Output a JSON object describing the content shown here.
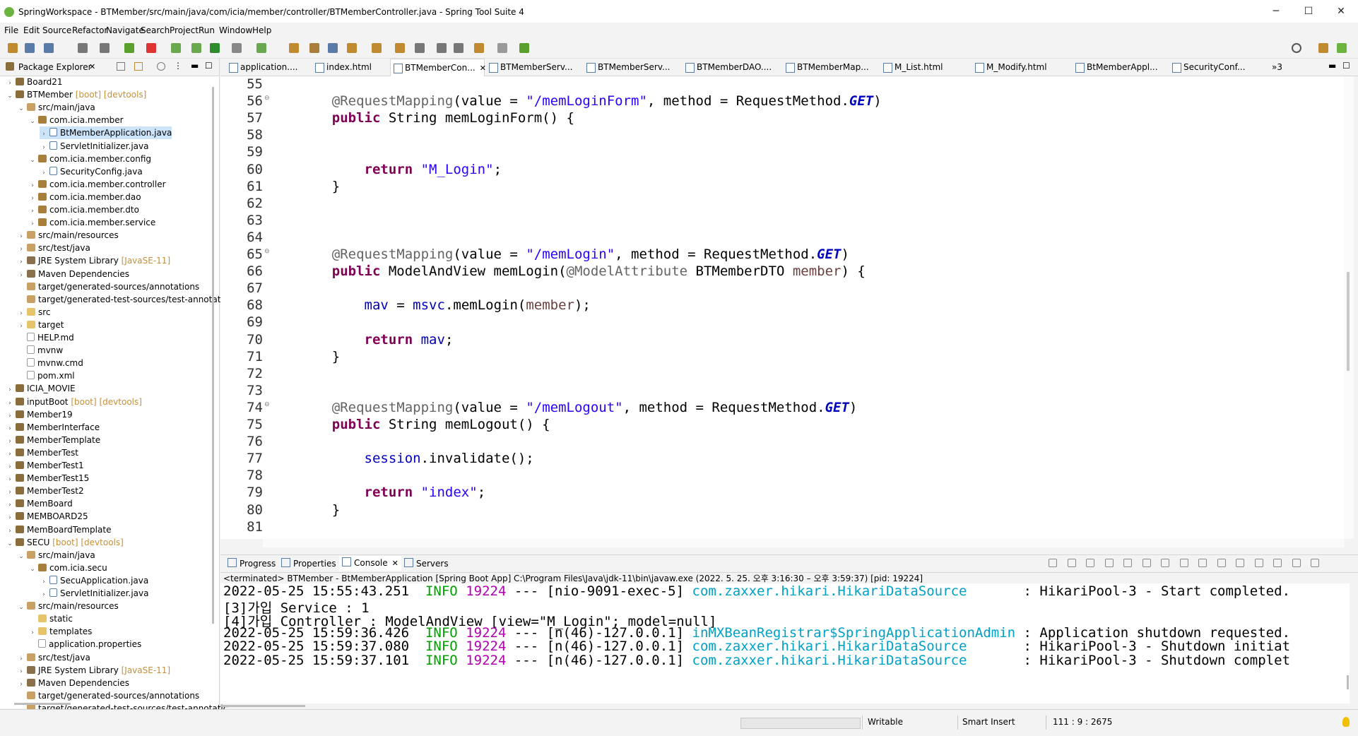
{
  "window": {
    "title": "SpringWorkspace - BTMember/src/main/java/com/icia/member/controller/BTMemberController.java - Spring Tool Suite 4",
    "minimize": "─",
    "maximize": "☐",
    "close": "✕"
  },
  "menu": [
    "File",
    "Edit",
    "Source",
    "Refactor",
    "Navigate",
    "Search",
    "Project",
    "Run",
    "Window",
    "Help"
  ],
  "package_explorer": {
    "title": "Package Explorer",
    "close": "✕",
    "tree": [
      {
        "label": "Board21",
        "deco": "",
        "depth": 0,
        "twisty": "›",
        "icon": "proj"
      },
      {
        "label": "BTMember",
        "deco": " [boot] [devtools]",
        "depth": 0,
        "twisty": "⌄",
        "icon": "proj"
      },
      {
        "label": "src/main/java",
        "deco": "",
        "depth": 1,
        "twisty": "⌄",
        "icon": "src"
      },
      {
        "label": "com.icia.member",
        "deco": "",
        "depth": 2,
        "twisty": "⌄",
        "icon": "pkg"
      },
      {
        "label": "BtMemberApplication.java",
        "deco": "",
        "depth": 3,
        "twisty": "›",
        "icon": "java",
        "selected": true
      },
      {
        "label": "ServletInitializer.java",
        "deco": "",
        "depth": 3,
        "twisty": "›",
        "icon": "java"
      },
      {
        "label": "com.icia.member.config",
        "deco": "",
        "depth": 2,
        "twisty": "⌄",
        "icon": "pkg"
      },
      {
        "label": "SecurityConfig.java",
        "deco": "",
        "depth": 3,
        "twisty": "›",
        "icon": "java"
      },
      {
        "label": "com.icia.member.controller",
        "deco": "",
        "depth": 2,
        "twisty": "›",
        "icon": "pkg"
      },
      {
        "label": "com.icia.member.dao",
        "deco": "",
        "depth": 2,
        "twisty": "›",
        "icon": "pkg"
      },
      {
        "label": "com.icia.member.dto",
        "deco": "",
        "depth": 2,
        "twisty": "›",
        "icon": "pkg"
      },
      {
        "label": "com.icia.member.service",
        "deco": "",
        "depth": 2,
        "twisty": "›",
        "icon": "pkg"
      },
      {
        "label": "src/main/resources",
        "deco": "",
        "depth": 1,
        "twisty": "›",
        "icon": "src"
      },
      {
        "label": "src/test/java",
        "deco": "",
        "depth": 1,
        "twisty": "›",
        "icon": "src"
      },
      {
        "label": "JRE System Library",
        "deco": " [JavaSE-11]",
        "depth": 1,
        "twisty": "›",
        "icon": "lib"
      },
      {
        "label": "Maven Dependencies",
        "deco": "",
        "depth": 1,
        "twisty": "›",
        "icon": "lib"
      },
      {
        "label": "target/generated-sources/annotations",
        "deco": "",
        "depth": 1,
        "twisty": "",
        "icon": "src"
      },
      {
        "label": "target/generated-test-sources/test-annotatic",
        "deco": "",
        "depth": 1,
        "twisty": "",
        "icon": "src"
      },
      {
        "label": "src",
        "deco": "",
        "depth": 1,
        "twisty": "›",
        "icon": "fold"
      },
      {
        "label": "target",
        "deco": "",
        "depth": 1,
        "twisty": "›",
        "icon": "fold"
      },
      {
        "label": "HELP.md",
        "deco": "",
        "depth": 1,
        "twisty": "",
        "icon": "file"
      },
      {
        "label": "mvnw",
        "deco": "",
        "depth": 1,
        "twisty": "",
        "icon": "file"
      },
      {
        "label": "mvnw.cmd",
        "deco": "",
        "depth": 1,
        "twisty": "",
        "icon": "file"
      },
      {
        "label": "pom.xml",
        "deco": "",
        "depth": 1,
        "twisty": "",
        "icon": "file"
      },
      {
        "label": "ICIA_MOVIE",
        "deco": "",
        "depth": 0,
        "twisty": "›",
        "icon": "proj"
      },
      {
        "label": "inputBoot",
        "deco": " [boot] [devtools]",
        "depth": 0,
        "twisty": "›",
        "icon": "proj"
      },
      {
        "label": "Member19",
        "deco": "",
        "depth": 0,
        "twisty": "›",
        "icon": "proj"
      },
      {
        "label": "MemberInterface",
        "deco": "",
        "depth": 0,
        "twisty": "›",
        "icon": "proj"
      },
      {
        "label": "MemberTemplate",
        "deco": "",
        "depth": 0,
        "twisty": "›",
        "icon": "proj"
      },
      {
        "label": "MemberTest",
        "deco": "",
        "depth": 0,
        "twisty": "›",
        "icon": "proj"
      },
      {
        "label": "MemberTest1",
        "deco": "",
        "depth": 0,
        "twisty": "›",
        "icon": "proj"
      },
      {
        "label": "MemberTest15",
        "deco": "",
        "depth": 0,
        "twisty": "›",
        "icon": "proj"
      },
      {
        "label": "MemberTest2",
        "deco": "",
        "depth": 0,
        "twisty": "›",
        "icon": "proj"
      },
      {
        "label": "MemBoard",
        "deco": "",
        "depth": 0,
        "twisty": "›",
        "icon": "proj"
      },
      {
        "label": "MEMBOARD25",
        "deco": "",
        "depth": 0,
        "twisty": "›",
        "icon": "proj"
      },
      {
        "label": "MemBoardTemplate",
        "deco": "",
        "depth": 0,
        "twisty": "›",
        "icon": "proj"
      },
      {
        "label": "SECU",
        "deco": " [boot] [devtools]",
        "depth": 0,
        "twisty": "⌄",
        "icon": "proj"
      },
      {
        "label": "src/main/java",
        "deco": "",
        "depth": 1,
        "twisty": "⌄",
        "icon": "src"
      },
      {
        "label": "com.icia.secu",
        "deco": "",
        "depth": 2,
        "twisty": "⌄",
        "icon": "pkg"
      },
      {
        "label": "SecuApplication.java",
        "deco": "",
        "depth": 3,
        "twisty": "›",
        "icon": "java"
      },
      {
        "label": "ServletInitializer.java",
        "deco": "",
        "depth": 3,
        "twisty": "›",
        "icon": "java"
      },
      {
        "label": "src/main/resources",
        "deco": "",
        "depth": 1,
        "twisty": "⌄",
        "icon": "src"
      },
      {
        "label": "static",
        "deco": "",
        "depth": 2,
        "twisty": "",
        "icon": "fold"
      },
      {
        "label": "templates",
        "deco": "",
        "depth": 2,
        "twisty": "›",
        "icon": "fold"
      },
      {
        "label": "application.properties",
        "deco": "",
        "depth": 2,
        "twisty": "",
        "icon": "file"
      },
      {
        "label": "src/test/java",
        "deco": "",
        "depth": 1,
        "twisty": "›",
        "icon": "src"
      },
      {
        "label": "JRE System Library",
        "deco": " [JavaSE-11]",
        "depth": 1,
        "twisty": "›",
        "icon": "lib"
      },
      {
        "label": "Maven Dependencies",
        "deco": "",
        "depth": 1,
        "twisty": "›",
        "icon": "lib"
      },
      {
        "label": "target/generated-sources/annotations",
        "deco": "",
        "depth": 1,
        "twisty": "",
        "icon": "src"
      },
      {
        "label": "target/generated-test-sources/test-annotatic",
        "deco": "",
        "depth": 1,
        "twisty": "",
        "icon": "src"
      }
    ]
  },
  "editor_tabs": [
    {
      "label": "application....",
      "active": false
    },
    {
      "label": "index.html",
      "active": false
    },
    {
      "label": "BTMemberCon...",
      "active": true
    },
    {
      "label": "BTMemberServ...",
      "active": false
    },
    {
      "label": "BTMemberServ...",
      "active": false
    },
    {
      "label": "BTMemberDAO....",
      "active": false
    },
    {
      "label": "BTMemberMap...",
      "active": false
    },
    {
      "label": "M_List.html",
      "active": false
    },
    {
      "label": "M_Modify.html",
      "active": false
    },
    {
      "label": "BtMemberAppl...",
      "active": false
    },
    {
      "label": "SecurityConf...",
      "active": false
    }
  ],
  "editor_overflow": "»3",
  "code_lines": [
    {
      "n": "55",
      "fold": false,
      "parts": []
    },
    {
      "n": "56",
      "fold": true,
      "parts": [
        [
          "    ",
          "t"
        ],
        [
          "@RequestMapping",
          "ann"
        ],
        [
          "(value = ",
          "t"
        ],
        [
          "\"/memLoginForm\"",
          "str"
        ],
        [
          ", method = RequestMethod.",
          "t"
        ],
        [
          "GET",
          "it"
        ],
        [
          ")",
          "t"
        ]
      ]
    },
    {
      "n": "57",
      "fold": false,
      "parts": [
        [
          "    ",
          "t"
        ],
        [
          "public",
          "kw"
        ],
        [
          " String memLoginForm() {",
          "t"
        ]
      ]
    },
    {
      "n": "58",
      "fold": false,
      "parts": []
    },
    {
      "n": "59",
      "fold": false,
      "parts": []
    },
    {
      "n": "60",
      "fold": false,
      "parts": [
        [
          "        ",
          "t"
        ],
        [
          "return",
          "kw"
        ],
        [
          " ",
          "t"
        ],
        [
          "\"M_Login\"",
          "str"
        ],
        [
          ";",
          "t"
        ]
      ]
    },
    {
      "n": "61",
      "fold": false,
      "parts": [
        [
          "    }",
          "t"
        ]
      ]
    },
    {
      "n": "62",
      "fold": false,
      "parts": []
    },
    {
      "n": "63",
      "fold": false,
      "parts": []
    },
    {
      "n": "64",
      "fold": false,
      "parts": []
    },
    {
      "n": "65",
      "fold": true,
      "parts": [
        [
          "    ",
          "t"
        ],
        [
          "@RequestMapping",
          "ann"
        ],
        [
          "(value = ",
          "t"
        ],
        [
          "\"/memLogin\"",
          "str"
        ],
        [
          ", method = RequestMethod.",
          "t"
        ],
        [
          "GET",
          "it"
        ],
        [
          ")",
          "t"
        ]
      ]
    },
    {
      "n": "66",
      "fold": false,
      "parts": [
        [
          "    ",
          "t"
        ],
        [
          "public",
          "kw"
        ],
        [
          " ModelAndView memLogin(",
          "t"
        ],
        [
          "@ModelAttribute",
          "ann"
        ],
        [
          " BTMemberDTO ",
          "t"
        ],
        [
          "member",
          "var"
        ],
        [
          ") {",
          "t"
        ]
      ]
    },
    {
      "n": "67",
      "fold": false,
      "parts": []
    },
    {
      "n": "68",
      "fold": false,
      "parts": [
        [
          "        ",
          "t"
        ],
        [
          "mav",
          "fld"
        ],
        [
          " = ",
          "t"
        ],
        [
          "msvc",
          "fld"
        ],
        [
          ".memLogin(",
          "t"
        ],
        [
          "member",
          "var"
        ],
        [
          ");",
          "t"
        ]
      ]
    },
    {
      "n": "69",
      "fold": false,
      "parts": []
    },
    {
      "n": "70",
      "fold": false,
      "parts": [
        [
          "        ",
          "t"
        ],
        [
          "return",
          "kw"
        ],
        [
          " ",
          "t"
        ],
        [
          "mav",
          "fld"
        ],
        [
          ";",
          "t"
        ]
      ]
    },
    {
      "n": "71",
      "fold": false,
      "parts": [
        [
          "    }",
          "t"
        ]
      ]
    },
    {
      "n": "72",
      "fold": false,
      "parts": []
    },
    {
      "n": "73",
      "fold": false,
      "parts": []
    },
    {
      "n": "74",
      "fold": true,
      "parts": [
        [
          "    ",
          "t"
        ],
        [
          "@RequestMapping",
          "ann"
        ],
        [
          "(value = ",
          "t"
        ],
        [
          "\"/memLogout\"",
          "str"
        ],
        [
          ", method = RequestMethod.",
          "t"
        ],
        [
          "GET",
          "it"
        ],
        [
          ")",
          "t"
        ]
      ]
    },
    {
      "n": "75",
      "fold": false,
      "parts": [
        [
          "    ",
          "t"
        ],
        [
          "public",
          "kw"
        ],
        [
          " String memLogout() {",
          "t"
        ]
      ]
    },
    {
      "n": "76",
      "fold": false,
      "parts": []
    },
    {
      "n": "77",
      "fold": false,
      "parts": [
        [
          "        ",
          "t"
        ],
        [
          "session",
          "fld"
        ],
        [
          ".invalidate();",
          "t"
        ]
      ]
    },
    {
      "n": "78",
      "fold": false,
      "parts": []
    },
    {
      "n": "79",
      "fold": false,
      "parts": [
        [
          "        ",
          "t"
        ],
        [
          "return",
          "kw"
        ],
        [
          " ",
          "t"
        ],
        [
          "\"index\"",
          "str"
        ],
        [
          ";",
          "t"
        ]
      ]
    },
    {
      "n": "80",
      "fold": false,
      "parts": [
        [
          "    }",
          "t"
        ]
      ]
    },
    {
      "n": "81",
      "fold": false,
      "parts": []
    }
  ],
  "console": {
    "tabs": [
      "Progress",
      "Properties",
      "Console",
      "Servers"
    ],
    "terminated": "<terminated> BTMember - BtMemberApplication [Spring Boot App] C:\\Program Files\\Java\\jdk-11\\bin\\javaw.exe  (2022. 5. 25. 오후 3:16:30 – 오후 3:59:37) [pid: 19224]",
    "lines": [
      [
        [
          "2022-05-25 15:55:43.251  ",
          "t"
        ],
        [
          "INFO",
          "cinfo"
        ],
        [
          " ",
          "t"
        ],
        [
          "19224",
          "cpid"
        ],
        [
          " --- [nio-9091-exec-5] ",
          "t"
        ],
        [
          "com.zaxxer.hikari.HikariDataSource      ",
          "clog"
        ],
        [
          " : HikariPool-3 - Start completed.",
          "t"
        ]
      ],
      [
        [
          "[3]가입 Service : 1",
          "t"
        ]
      ],
      [
        [
          "[4]가입 Controller : ModelAndView [view=\"M_Login\"; model=null]",
          "t"
        ]
      ],
      [
        [
          "2022-05-25 15:59:36.426  ",
          "t"
        ],
        [
          "INFO",
          "cinfo"
        ],
        [
          " ",
          "t"
        ],
        [
          "19224",
          "cpid"
        ],
        [
          " --- [n(46)-127.0.0.1] ",
          "t"
        ],
        [
          "inMXBeanRegistrar$SpringApplicationAdmin",
          "clog"
        ],
        [
          " : Application shutdown requested.",
          "t"
        ]
      ],
      [
        [
          "2022-05-25 15:59:37.080  ",
          "t"
        ],
        [
          "INFO",
          "cinfo"
        ],
        [
          " ",
          "t"
        ],
        [
          "19224",
          "cpid"
        ],
        [
          " --- [n(46)-127.0.0.1] ",
          "t"
        ],
        [
          "com.zaxxer.hikari.HikariDataSource      ",
          "clog"
        ],
        [
          " : HikariPool-3 - Shutdown initiat",
          "t"
        ]
      ],
      [
        [
          "2022-05-25 15:59:37.101  ",
          "t"
        ],
        [
          "INFO",
          "cinfo"
        ],
        [
          " ",
          "t"
        ],
        [
          "19224",
          "cpid"
        ],
        [
          " --- [n(46)-127.0.0.1] ",
          "t"
        ],
        [
          "com.zaxxer.hikari.HikariDataSource      ",
          "clog"
        ],
        [
          " : HikariPool-3 - Shutdown complet",
          "t"
        ]
      ]
    ]
  },
  "status": {
    "writable": "Writable",
    "insert_mode": "Smart Insert",
    "position": "111 : 9 : 2675"
  },
  "colors": {
    "keyword": "#7f0055",
    "string": "#2a00ff",
    "annotation": "#646464",
    "field": "#0000c0",
    "info": "#00a000",
    "pid": "#b000b0",
    "logger": "#00a0c8"
  }
}
